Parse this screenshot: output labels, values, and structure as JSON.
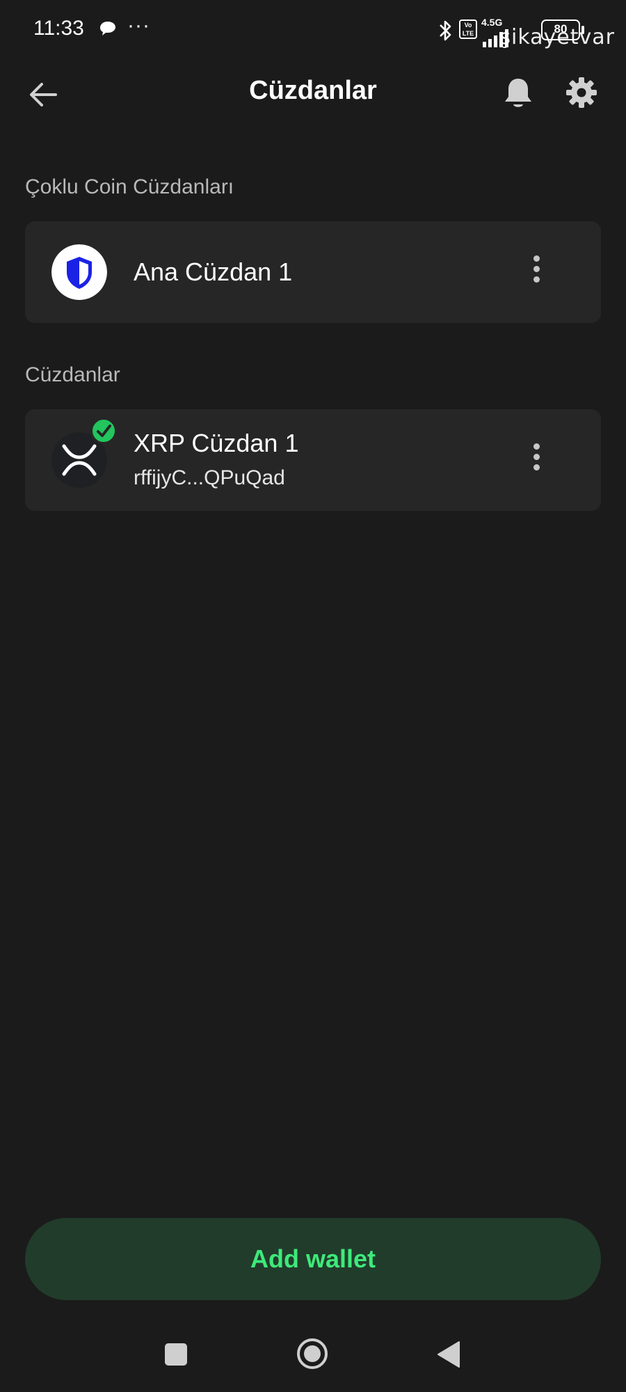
{
  "status_bar": {
    "time": "11:33",
    "more_indicator": "···",
    "volte_label": "Vo LTE",
    "network": "4.5G",
    "battery": "80",
    "watermark": "şikayetvar"
  },
  "header": {
    "title": "Cüzdanlar",
    "icons": [
      "back-arrow-icon",
      "bell-icon",
      "gear-icon"
    ]
  },
  "sections": {
    "multi_coin": {
      "label": "Çoklu Coin Cüzdanları",
      "wallets": [
        {
          "name": "Ana Cüzdan 1",
          "icon": "shield-icon"
        }
      ]
    },
    "wallets": {
      "label": "Cüzdanlar",
      "items": [
        {
          "name": "XRP Cüzdan 1",
          "address": "rffijyC...QPuQad",
          "icon": "xrp-logo-icon",
          "selected": true
        }
      ]
    }
  },
  "actions": {
    "add_wallet": "Add wallet"
  },
  "colors": {
    "background": "#1b1b1b",
    "card": "#262626",
    "accent": "#3ee97a",
    "button_bg": "#213c2b",
    "shield_blue": "#1a22e6"
  }
}
